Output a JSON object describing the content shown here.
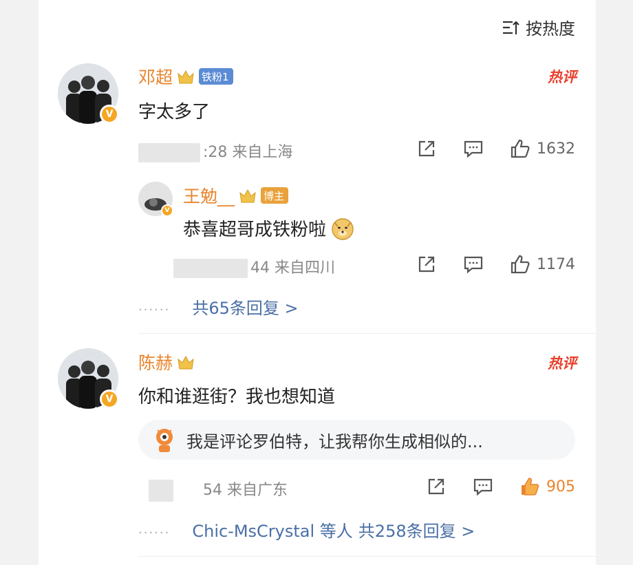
{
  "sort": {
    "label": "按热度"
  },
  "comments": [
    {
      "author": "邓超",
      "tag": "铁粉1",
      "hot_label": "热评",
      "text": "字太多了",
      "time": ":28",
      "location": "来自上海",
      "likes": "1632",
      "reply": {
        "author": "王勉__",
        "tag": "博主",
        "text": "恭喜超哥成铁粉啦",
        "time": "44",
        "location": "来自四川",
        "likes": "1174"
      },
      "more_replies": "共65条回复 >"
    },
    {
      "author": "陈赫",
      "hot_label": "热评",
      "text": "你和谁逛街？我也想知道",
      "bot_text": "我是评论罗伯特，让我帮你生成相似的...",
      "time": "54",
      "location": "来自广东",
      "likes": "905",
      "more_users": "Chic-MsCrystal 等人",
      "more_replies": "共258条回复 >"
    }
  ],
  "colors": {
    "name": "#e9842c",
    "link": "#4a6fa5",
    "hot": "#e8402d"
  }
}
